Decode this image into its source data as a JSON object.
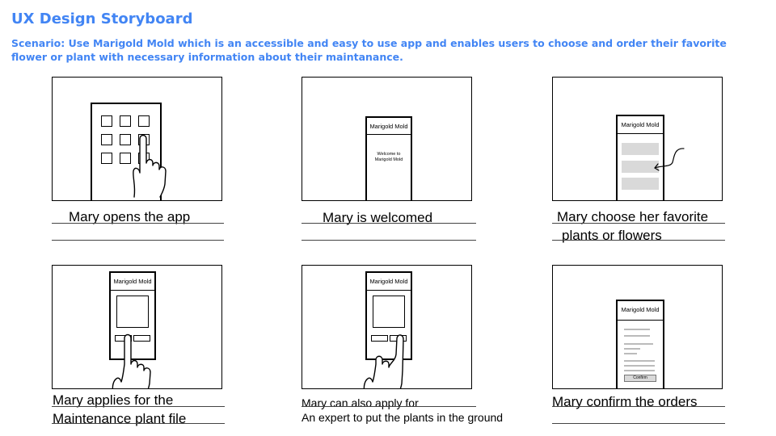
{
  "title": "UX Design Storyboard",
  "scenario": "Scenario: Use Marigold Mold which is an accessible and easy to use app and enables users to choose and order their favorite flower or plant with necessary information about their maintanance.",
  "panels": [
    {
      "caption": [
        "Mary opens the app"
      ]
    },
    {
      "app_name": "Marigold Mold",
      "welcome_line1": "Welcome to",
      "welcome_line2": "Marigold Mold",
      "caption": [
        "Mary is welcomed"
      ]
    },
    {
      "app_name": "Marigold Mold",
      "caption": [
        "Mary choose her favorite",
        "plants or flowers"
      ]
    },
    {
      "app_name": "Marigold Mold",
      "caption": [
        "Mary applies for the",
        "Maintenance plant file"
      ]
    },
    {
      "app_name": "Marigold Mold",
      "caption": [
        "Mary can also apply for",
        "An expert to put the plants in the ground"
      ]
    },
    {
      "app_name": "Marigold Mold",
      "confirm_label": "Confirm",
      "caption": [
        "Mary confirm the orders"
      ]
    }
  ],
  "colors": {
    "heading": "#4285f4",
    "placeholder": "#d9d9d9"
  }
}
